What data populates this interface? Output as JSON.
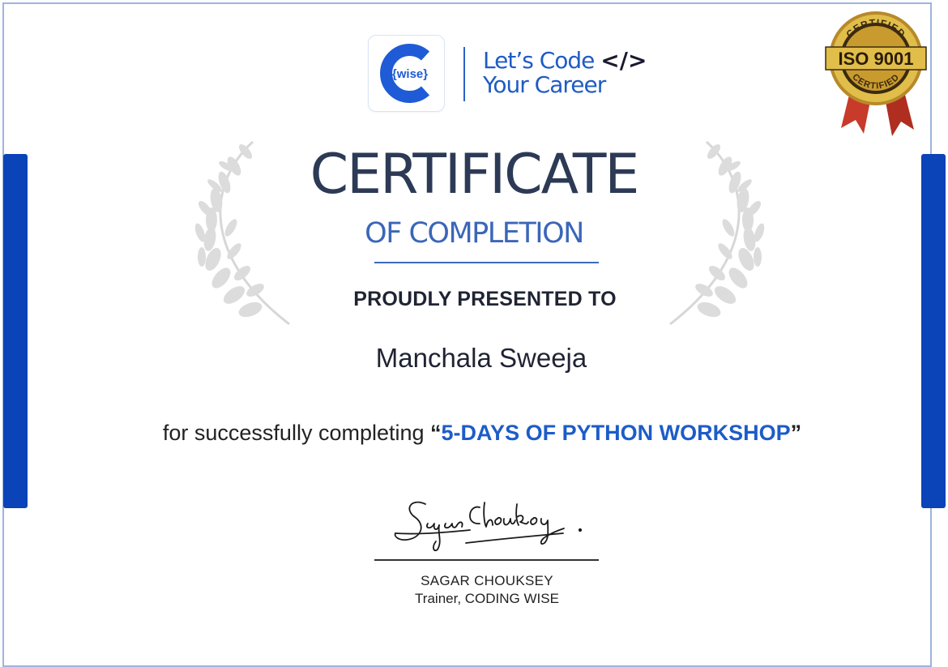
{
  "header": {
    "logo_text": "{wise}",
    "tagline_line1": "Let’s Code",
    "tagline_code_glyph": "</>",
    "tagline_line2": "Your Career"
  },
  "seal": {
    "top_text": "CERTIFIED",
    "main_text": "ISO 9001",
    "bottom_text": "CERTIFIED"
  },
  "certificate": {
    "title": "CERTIFICATE",
    "subtitle": "OF COMPLETION",
    "presented_label": "PROUDLY PRESENTED TO",
    "recipient": "Manchala Sweeja",
    "completion_prefix": "for successfully completing ",
    "open_quote": "“",
    "course": "5-DAYS OF PYTHON WORKSHOP",
    "close_quote": "”"
  },
  "signer": {
    "name": "SAGAR CHOUKSEY",
    "role": "Trainer, CODING WISE"
  },
  "colors": {
    "brand_blue": "#0b43b8",
    "accent_blue": "#1d5cc8",
    "title_navy": "#2c3a55",
    "seal_gold": "#c9a233",
    "ribbon_red": "#c83a2a"
  }
}
